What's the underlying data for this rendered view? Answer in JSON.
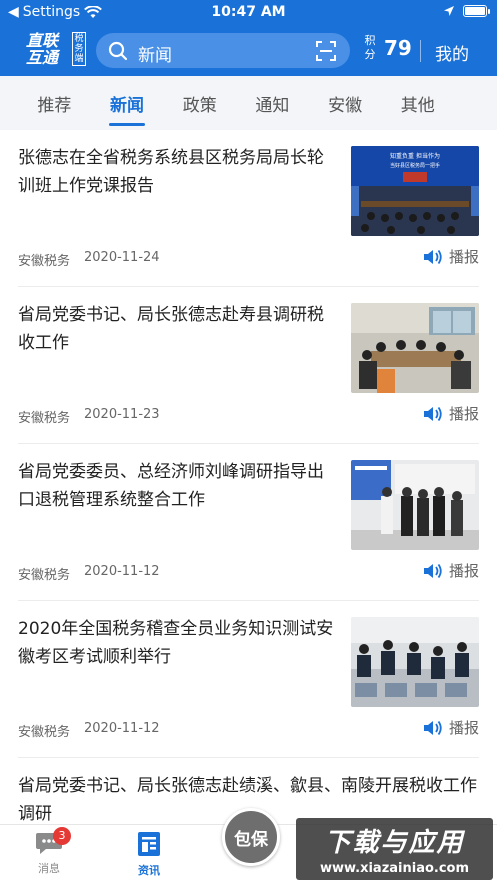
{
  "status": {
    "carrier": "Settings",
    "time": "10:47 AM"
  },
  "header": {
    "logo_main": "直联互通",
    "logo_side": "税务端",
    "search_placeholder": "新闻",
    "points_label": "积分",
    "points_value": "79",
    "mine_label": "我的"
  },
  "tabs": [
    {
      "label": "推荐"
    },
    {
      "label": "新闻"
    },
    {
      "label": "政策"
    },
    {
      "label": "通知"
    },
    {
      "label": "安徽"
    },
    {
      "label": "其他"
    }
  ],
  "active_tab": "新闻",
  "articles": [
    {
      "title": "张德志在全省税务系统县区税务局局长轮训班上作党课报告",
      "source": "安徽税务",
      "date": "2020-11-24",
      "broadcast": "播报",
      "thumb_text": "知重负重 担当作为\n当好县区税务局一把手"
    },
    {
      "title": "省局党委书记、局长张德志赴寿县调研税收工作",
      "source": "安徽税务",
      "date": "2020-11-23",
      "broadcast": "播报"
    },
    {
      "title": "省局党委委员、总经济师刘峰调研指导出口退税管理系统整合工作",
      "source": "安徽税务",
      "date": "2020-11-12",
      "broadcast": "播报"
    },
    {
      "title": "2020年全国税务稽查全员业务知识测试安徽考区考试顺利举行",
      "source": "安徽税务",
      "date": "2020-11-12",
      "broadcast": "播报"
    },
    {
      "title": "省局党委书记、局长张德志赴绩溪、歙县、南陵开展税收工作调研"
    }
  ],
  "bottom": {
    "messages_label": "消息",
    "messages_badge": "3",
    "news_label": "资讯",
    "baobao_label": "包保",
    "watermark_main": "下载与应用",
    "watermark_url": "www.xiazainiao.com"
  },
  "colors": {
    "brand_blue": "#1a72d8",
    "badge_red": "#e53935"
  }
}
